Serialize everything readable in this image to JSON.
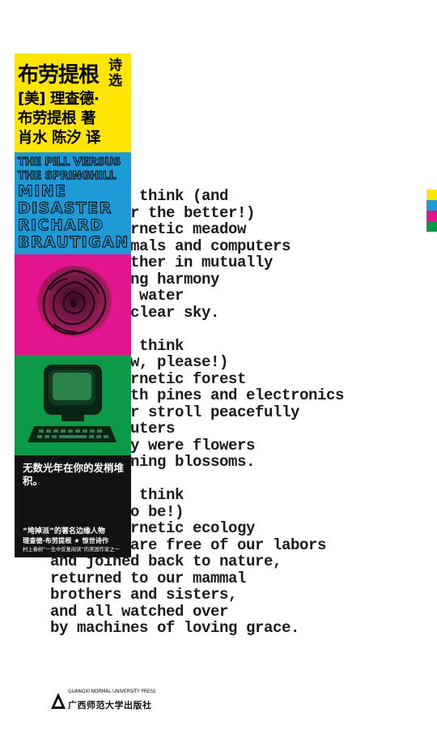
{
  "poem": {
    "lines": [
      "I like to think (and",
      "the sooner the better!)",
      "of a cybernetic meadow",
      "where mammals and computers",
      "live together in mutually",
      "programming harmony",
      "like pure water",
      "touching clear sky.",
      "",
      "I like to think",
      "(right now, please!)",
      "of a cybernetic forest",
      "filled with pines and electronics",
      "where deer stroll peacefully",
      "past computers",
      "as if they were flowers",
      "with spinning blossoms.",
      "",
      "I like to think",
      "(it has to be!)",
      "of a cybernetic ecology",
      "where we are free of our labors",
      "and joined back to nature,",
      "returned to our mammal",
      "brothers and sisters,",
      "and all watched over",
      "by machines of loving grace."
    ]
  },
  "cover": {
    "title_zh": "布劳提根",
    "title_suffix": "诗选",
    "author_zh": "[美] 理查德·",
    "author_zh_2": "布劳提根 著",
    "translators": "肖水 陈汐 译",
    "title_en": [
      "THE PILL VERSUS",
      "THE SPRINGHILL",
      "MINE",
      "DISASTER",
      "RICHARD",
      "BRAUTIGAN"
    ],
    "tagline": "无数光年在你的发梢堆积。",
    "blurb_1": "“垮掉派”的著名边缘人物",
    "blurb_2": "理查德·布劳提根 ★ 惊世诗作",
    "blurb_3": "村上春树“一生中反复阅读”的美国作家之一"
  },
  "colors": {
    "yellow": "#ffe600",
    "blue": "#1e9bd7",
    "magenta": "#e3158e",
    "green": "#0c9a48",
    "black": "#121212"
  },
  "swatch_colors": [
    "#ffe600",
    "#1e9bd7",
    "#e3158e",
    "#0c9a48"
  ],
  "publisher": {
    "name_en": "GUANGXI NORMAL UNIVERSITY PRESS",
    "name_zh": "广西师范大学出版社"
  }
}
